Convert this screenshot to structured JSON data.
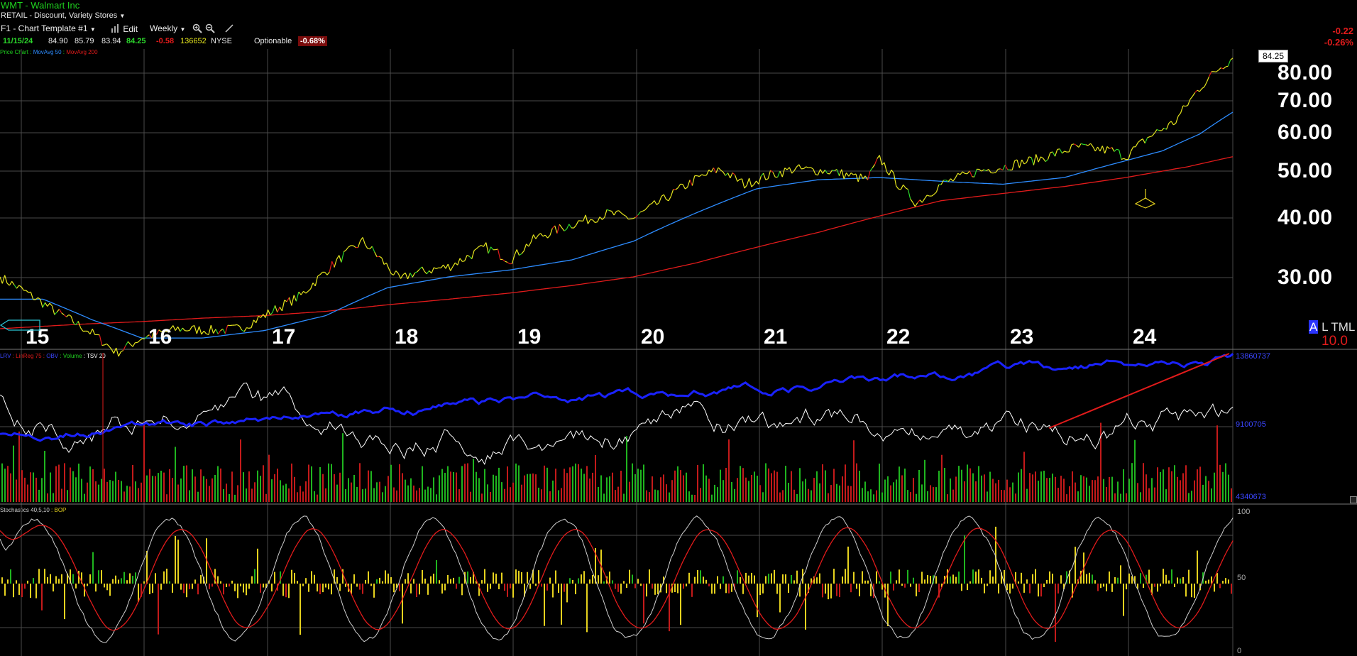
{
  "header": {
    "title": "WMT - Walmart Inc",
    "sector": "RETAIL - Discount, Variety Stores",
    "template_label": "F1 - Chart Template #1",
    "edit_label": "Edit",
    "period_label": "Weekly",
    "change_abs": "-0.22",
    "change_pct": "-0.26%"
  },
  "quote": {
    "date": "11/15/24",
    "open": "84.90",
    "high": "85.79",
    "low": "83.94",
    "close": "84.25",
    "change": "-0.58",
    "volume": "136652",
    "exchange": "NYSE",
    "optionable": "Optionable",
    "pct_change": "-0.68%"
  },
  "indicators": {
    "top": [
      {
        "label": "Price Chart",
        "color": "#1fd21f"
      },
      {
        "label": ":",
        "color": "#1fd21f"
      },
      {
        "label": "MovAvg 50",
        "color": "#2d8cff"
      },
      {
        "label": ":",
        "color": "#1fd21f"
      },
      {
        "label": "MovAvg 200",
        "color": "#e11b1b"
      }
    ],
    "middle": [
      {
        "label": "LRV",
        "color": "#3b46ff"
      },
      {
        "label": ":",
        "color": "#e11b1b"
      },
      {
        "label": "LinReg 75",
        "color": "#e11b1b"
      },
      {
        "label": ":",
        "color": "#e11b1b"
      },
      {
        "label": "OBV",
        "color": "#3b46ff"
      },
      {
        "label": ":",
        "color": "#1fd21f"
      },
      {
        "label": "Volume",
        "color": "#1fd21f"
      },
      {
        "label": ":",
        "color": "#fff"
      },
      {
        "label": "TSV 20",
        "color": "#ffffff"
      }
    ],
    "bottom": [
      {
        "label": "Stochastics 40,5,10",
        "color": "#cccccc"
      },
      {
        "label": ":",
        "color": "#e6d21e"
      },
      {
        "label": "BOP",
        "color": "#e6d21e"
      }
    ]
  },
  "last_price_box": "84.25",
  "scale_mode": {
    "a": "A",
    "rest": "L TML"
  },
  "scale_value": "10.0",
  "volume_labels": [
    "13860737",
    "9100705",
    "4340673"
  ],
  "stoch_labels": [
    "100",
    "50",
    "0"
  ],
  "colors": {
    "price_up": "#2bd62b",
    "price_neutral": "#e6e61e",
    "price_down": "#e11b1b",
    "ma50": "#2d8cff",
    "ma200": "#e11b1b",
    "obv": "#1a22ff",
    "tsv": "#ffffff",
    "grid": "#4a4a4a"
  },
  "chart_data": {
    "type": "line",
    "title": "WMT - Walmart Inc",
    "period": "Weekly",
    "x_tick_labels": [
      "15",
      "16",
      "17",
      "18",
      "19",
      "20",
      "21",
      "22",
      "23",
      "24"
    ],
    "y_tick_labels": [
      "80.00",
      "70.00",
      "60.00",
      "50.00",
      "40.00",
      "30.00"
    ],
    "ylim": [
      19,
      86
    ],
    "y_scale": "log",
    "grid": true,
    "series": [
      {
        "name": "Price Chart",
        "x": [
          2014.85,
          2015.0,
          2015.3,
          2015.6,
          2015.8,
          2016.0,
          2016.3,
          2016.6,
          2016.8,
          2017.0,
          2017.3,
          2017.6,
          2017.8,
          2018.0,
          2018.1,
          2018.2,
          2018.5,
          2018.8,
          2019.0,
          2019.2,
          2019.5,
          2019.8,
          2020.0,
          2020.2,
          2020.5,
          2020.7,
          2020.9,
          2021.1,
          2021.3,
          2021.6,
          2021.9,
          2022.0,
          2022.15,
          2022.3,
          2022.5,
          2022.8,
          2023.0,
          2023.3,
          2023.6,
          2023.9,
          2024.0,
          2024.2,
          2024.4,
          2024.6,
          2024.75,
          2024.87
        ],
        "values": [
          29.5,
          28.0,
          25.0,
          22.5,
          20.5,
          22.0,
          23.0,
          22.8,
          23.0,
          24.5,
          27.0,
          32.0,
          35.0,
          31.0,
          29.0,
          30.0,
          31.0,
          34.0,
          32.0,
          35.5,
          38.0,
          40.0,
          39.0,
          42.0,
          47.0,
          49.5,
          46.0,
          48.0,
          49.5,
          49.0,
          47.0,
          52.0,
          46.0,
          42.0,
          46.0,
          49.0,
          50.0,
          52.0,
          55.0,
          54.0,
          52.5,
          58.0,
          62.0,
          73.0,
          80.0,
          84.25
        ]
      },
      {
        "name": "MovAvg 50",
        "x": [
          2014.85,
          2015.2,
          2015.6,
          2016.0,
          2016.5,
          2017.0,
          2017.5,
          2018.0,
          2018.5,
          2019.0,
          2019.5,
          2020.0,
          2020.5,
          2021.0,
          2021.5,
          2022.0,
          2022.3,
          2022.6,
          2023.0,
          2023.5,
          2024.0,
          2024.3,
          2024.6,
          2024.87
        ],
        "values": [
          26.5,
          26.5,
          24.0,
          22.0,
          22.0,
          22.8,
          24.5,
          28.0,
          29.5,
          30.5,
          32.0,
          35.0,
          40.0,
          45.0,
          47.0,
          47.5,
          47.0,
          46.5,
          46.0,
          47.5,
          51.5,
          54.0,
          58.5,
          65.0
        ]
      },
      {
        "name": "MovAvg 200",
        "x": [
          2014.85,
          2015.5,
          2016.0,
          2016.5,
          2017.0,
          2017.5,
          2018.0,
          2018.5,
          2019.0,
          2019.5,
          2020.0,
          2020.5,
          2021.0,
          2021.5,
          2022.0,
          2022.5,
          2023.0,
          2023.5,
          2024.0,
          2024.5,
          2024.87
        ],
        "values": [
          23.0,
          23.5,
          23.8,
          24.2,
          24.5,
          25.0,
          25.8,
          26.5,
          27.3,
          28.3,
          29.5,
          31.5,
          34.0,
          36.5,
          39.5,
          42.5,
          44.0,
          45.5,
          47.5,
          50.0,
          52.5
        ]
      }
    ],
    "volume_axis_labels": [
      "13860737",
      "9100705",
      "4340673"
    ],
    "stochastics_axis_labels": [
      "100",
      "50",
      "0"
    ]
  }
}
